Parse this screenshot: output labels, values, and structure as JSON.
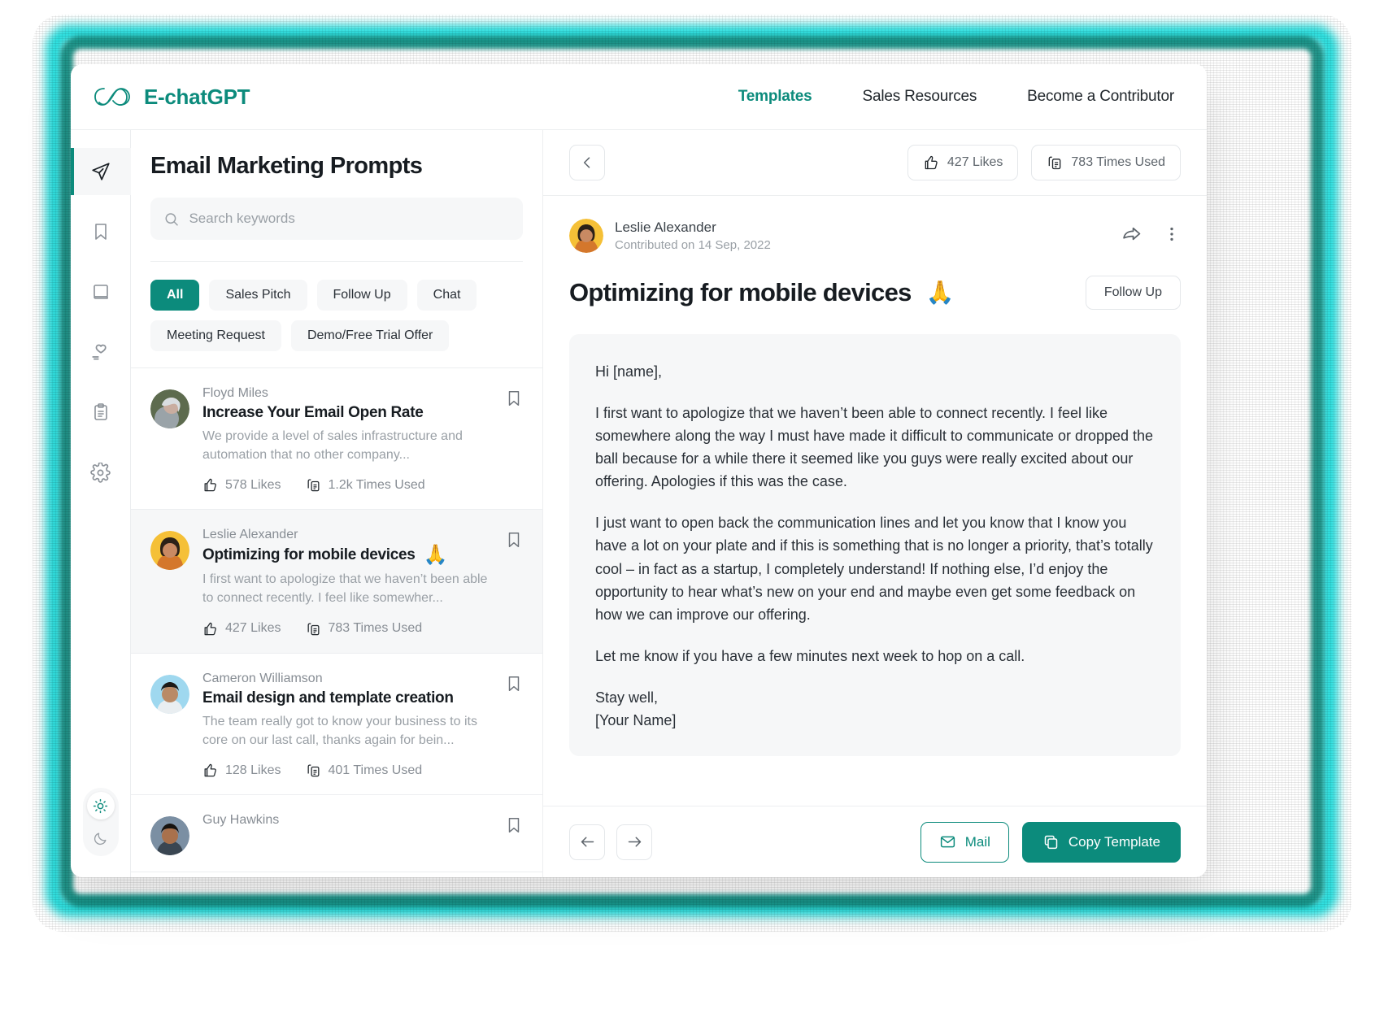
{
  "header": {
    "brand": "E-chatGPT",
    "nav": [
      {
        "label": "Templates",
        "active": true
      },
      {
        "label": "Sales Resources",
        "active": false
      },
      {
        "label": "Become a Contributor",
        "active": false
      }
    ]
  },
  "rail": {
    "items": [
      {
        "icon": "paper-plane-icon",
        "active": true
      },
      {
        "icon": "bookmark-icon",
        "active": false
      },
      {
        "icon": "book-icon",
        "active": false
      },
      {
        "icon": "heart-hand-icon",
        "active": false
      },
      {
        "icon": "clipboard-icon",
        "active": false
      },
      {
        "icon": "gear-icon",
        "active": false
      }
    ],
    "theme": {
      "light_icon": "sun-icon",
      "dark_icon": "moon-icon",
      "active": "light"
    }
  },
  "list": {
    "title": "Email Marketing Prompts",
    "search_placeholder": "Search keywords",
    "search_value": "",
    "chips": [
      {
        "label": "All",
        "active": true
      },
      {
        "label": "Sales Pitch",
        "active": false
      },
      {
        "label": "Follow Up",
        "active": false
      },
      {
        "label": "Chat",
        "active": false
      },
      {
        "label": "Meeting Request",
        "active": false
      },
      {
        "label": "Demo/Free Trial Offer",
        "active": false
      }
    ],
    "items": [
      {
        "author": "Floyd Miles",
        "title": "Increase Your Email Open Rate",
        "emoji": "",
        "snippet": "We provide a level of sales infrastructure and automation that no other company...",
        "likes": "578 Likes",
        "used": "1.2k Times Used",
        "selected": false
      },
      {
        "author": "Leslie Alexander",
        "title": "Optimizing for mobile devices",
        "emoji": "🙏",
        "snippet": "I first want to apologize that we haven’t been able to connect recently. I feel like somewher...",
        "likes": "427 Likes",
        "used": "783 Times Used",
        "selected": true
      },
      {
        "author": "Cameron Williamson",
        "title": "Email design and template creation",
        "emoji": "",
        "snippet": "The team really got to know your business to its core on our last call, thanks again for bein...",
        "likes": "128 Likes",
        "used": "401 Times Used",
        "selected": false
      },
      {
        "author": "Guy Hawkins",
        "title": "",
        "emoji": "",
        "snippet": "",
        "likes": "",
        "used": "",
        "selected": false
      }
    ]
  },
  "detail": {
    "back_icon": "chevron-left-icon",
    "stats": [
      {
        "icon": "thumbs-up-icon",
        "label": "427 Likes"
      },
      {
        "icon": "clipboard-copy-icon",
        "label": "783 Times Used"
      }
    ],
    "author": "Leslie Alexander",
    "contributed": "Contributed on 14 Sep, 2022",
    "share_icon": "share-icon",
    "more_icon": "more-vertical-icon",
    "title": "Optimizing for mobile devices",
    "title_emoji": "🙏",
    "tag": "Follow Up",
    "email": [
      "Hi [name],",
      "I first want to apologize that we haven’t been able to connect recently. I feel like somewhere along the way I must have made it difficult to communicate or dropped the ball because for a while there it seemed like you guys were really excited about our offering. Apologies if this was the case.",
      "I just want to open back the communication lines and let you know that I know you have a lot on your plate and if this is something that is no longer a priority, that’s totally cool – in fact as a startup, I completely understand! If nothing else, I’d enjoy the opportunity to hear what’s new on your end and maybe even get some feedback on how we can improve our offering.",
      "Let me know if you have a few minutes next week to hop on a call.",
      "Stay well,\n[Your Name]"
    ],
    "prev_icon": "arrow-left-icon",
    "next_icon": "arrow-right-icon",
    "mail_label": "Mail",
    "copy_label": "Copy Template"
  },
  "colors": {
    "accent": "#0c8b7c",
    "glow": "#00d7d7",
    "text": "#171c21",
    "muted": "#9aa0a6"
  }
}
